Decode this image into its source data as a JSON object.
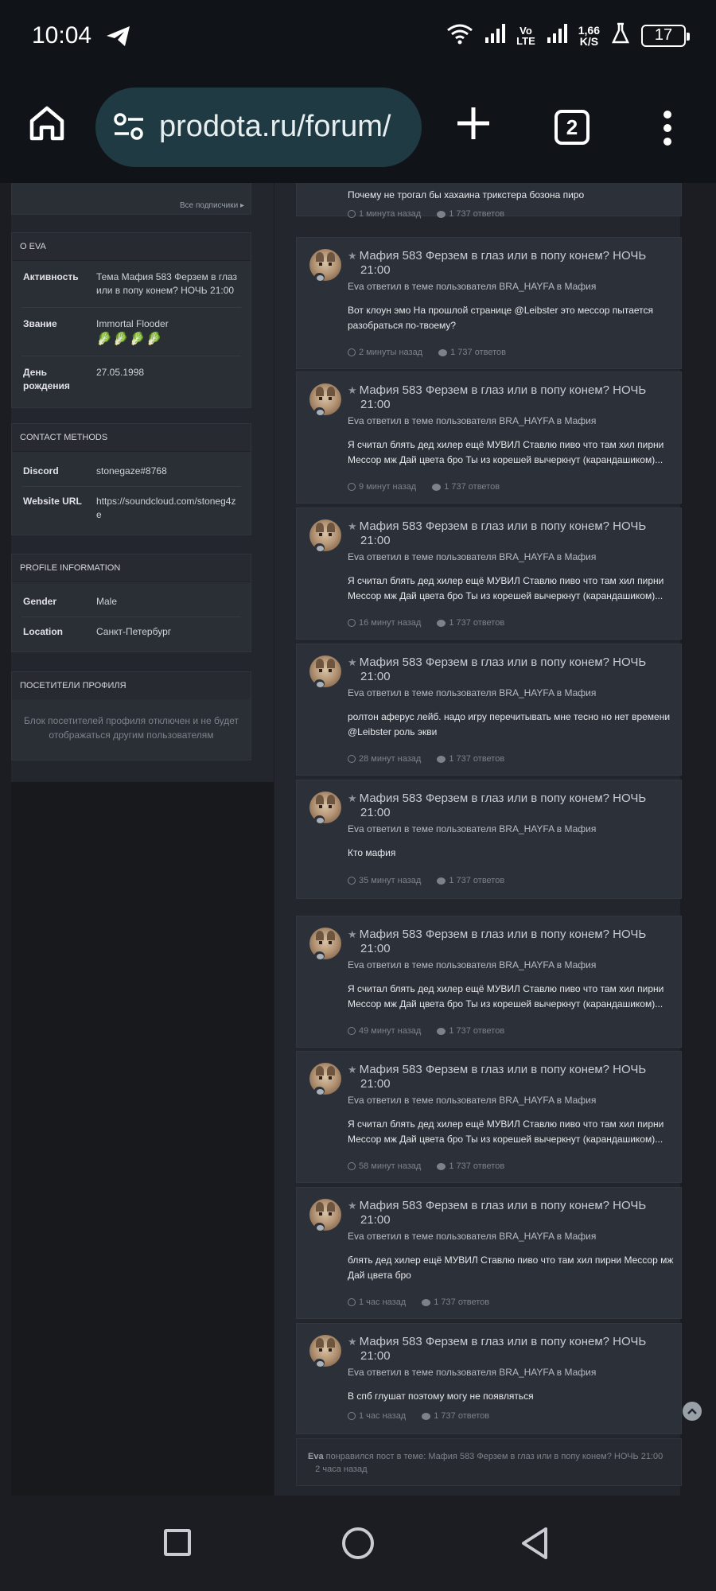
{
  "status_bar": {
    "time": "10:04",
    "network_top": "Vo",
    "network_bottom": "LTE",
    "speed_top": "1,66",
    "speed_bottom": "K/S",
    "battery": "17"
  },
  "browser": {
    "url": "prodota.ru/forum/",
    "tab_count": "2"
  },
  "sidebar": {
    "all_subscribers_link": "Все подписчики",
    "about": {
      "heading": "О EVA",
      "rows": [
        {
          "label": "Активность",
          "value": "Тема Мафия 583 Ферзем в глаз или в попу конем? НОЧЬ 21:00"
        },
        {
          "label": "Звание",
          "value": "Immortal Flooder"
        },
        {
          "label": "День рождения",
          "value": "27.05.1998"
        }
      ],
      "rank_icons": "🥬🥬🥬🥬"
    },
    "contact": {
      "heading": "CONTACT METHODS",
      "rows": [
        {
          "label": "Discord",
          "value": "stonegaze#8768"
        },
        {
          "label": "Website URL",
          "value": "https://soundcloud.com/stoneg4ze"
        }
      ]
    },
    "profile_info": {
      "heading": "PROFILE INFORMATION",
      "rows": [
        {
          "label": "Gender",
          "value": "Male"
        },
        {
          "label": "Location",
          "value": "Санкт-Петербург"
        }
      ]
    },
    "visitors": {
      "heading": "ПОСЕТИТЕЛИ ПРОФИЛЯ",
      "note": "Блок посетителей профиля отключен и не будет отображаться другим пользователям"
    }
  },
  "activity": {
    "top_partial": {
      "body": "Почему не трогал бы хахаина трикстера бозона пиро",
      "time": "1 минута назад",
      "replies": "1 737 ответов"
    },
    "topic_title": "Мафия 583 Ферзем в глаз или в попу конем? НОЧЬ 21:00",
    "subtitle": "Eva ответил в теме пользователя BRA_HAYFA в Мафия",
    "replies": "1 737 ответов",
    "items": [
      {
        "body": "Вот клоун эмо На прошлой странице @Leibster это мессор пытается разобраться по-твоему?",
        "time": "2 минуты назад"
      },
      {
        "body": "Я считал блять дед хилер ещё МУВИЛ Ставлю пиво что там хил пирни Мессор мж Дай цвета бро Ты из корешей вычеркнут (карандашиком)...",
        "time": "9 минут назад"
      },
      {
        "body": "Я считал блять дед хилер ещё МУВИЛ Ставлю пиво что там хил пирни Мессор мж Дай цвета бро Ты из корешей вычеркнут (карандашиком)...",
        "time": "16 минут назад"
      },
      {
        "body": "ролтон аферус лейб. надо игру перечитывать мне тесно но нет времени @Leibster роль экви",
        "time": "28 минут назад"
      },
      {
        "body": "Кто мафия",
        "time": "35 минут назад"
      },
      {
        "body": "Я считал блять дед хилер ещё МУВИЛ Ставлю пиво что там хил пирни Мессор мж Дай цвета бро Ты из корешей вычеркнут (карандашиком)...",
        "time": "49 минут назад"
      },
      {
        "body": "Я считал блять дед хилер ещё МУВИЛ Ставлю пиво что там хил пирни Мессор мж Дай цвета бро Ты из корешей вычеркнут (карандашиком)...",
        "time": "58 минут назад"
      },
      {
        "body": "блять дед хилер ещё МУВИЛ Ставлю пиво что там хил пирни Мессор мж Дай цвета бро",
        "time": "1 час назад"
      },
      {
        "body": "В спб глушат поэтому могу не появляться",
        "time": "1 час назад"
      }
    ],
    "liked": {
      "user": "Eva",
      "text": "понравился пост в теме: Мафия 583 Ферзем в глаз или в попу конем? НОЧЬ 21:00",
      "time": "2 часа назад"
    }
  }
}
